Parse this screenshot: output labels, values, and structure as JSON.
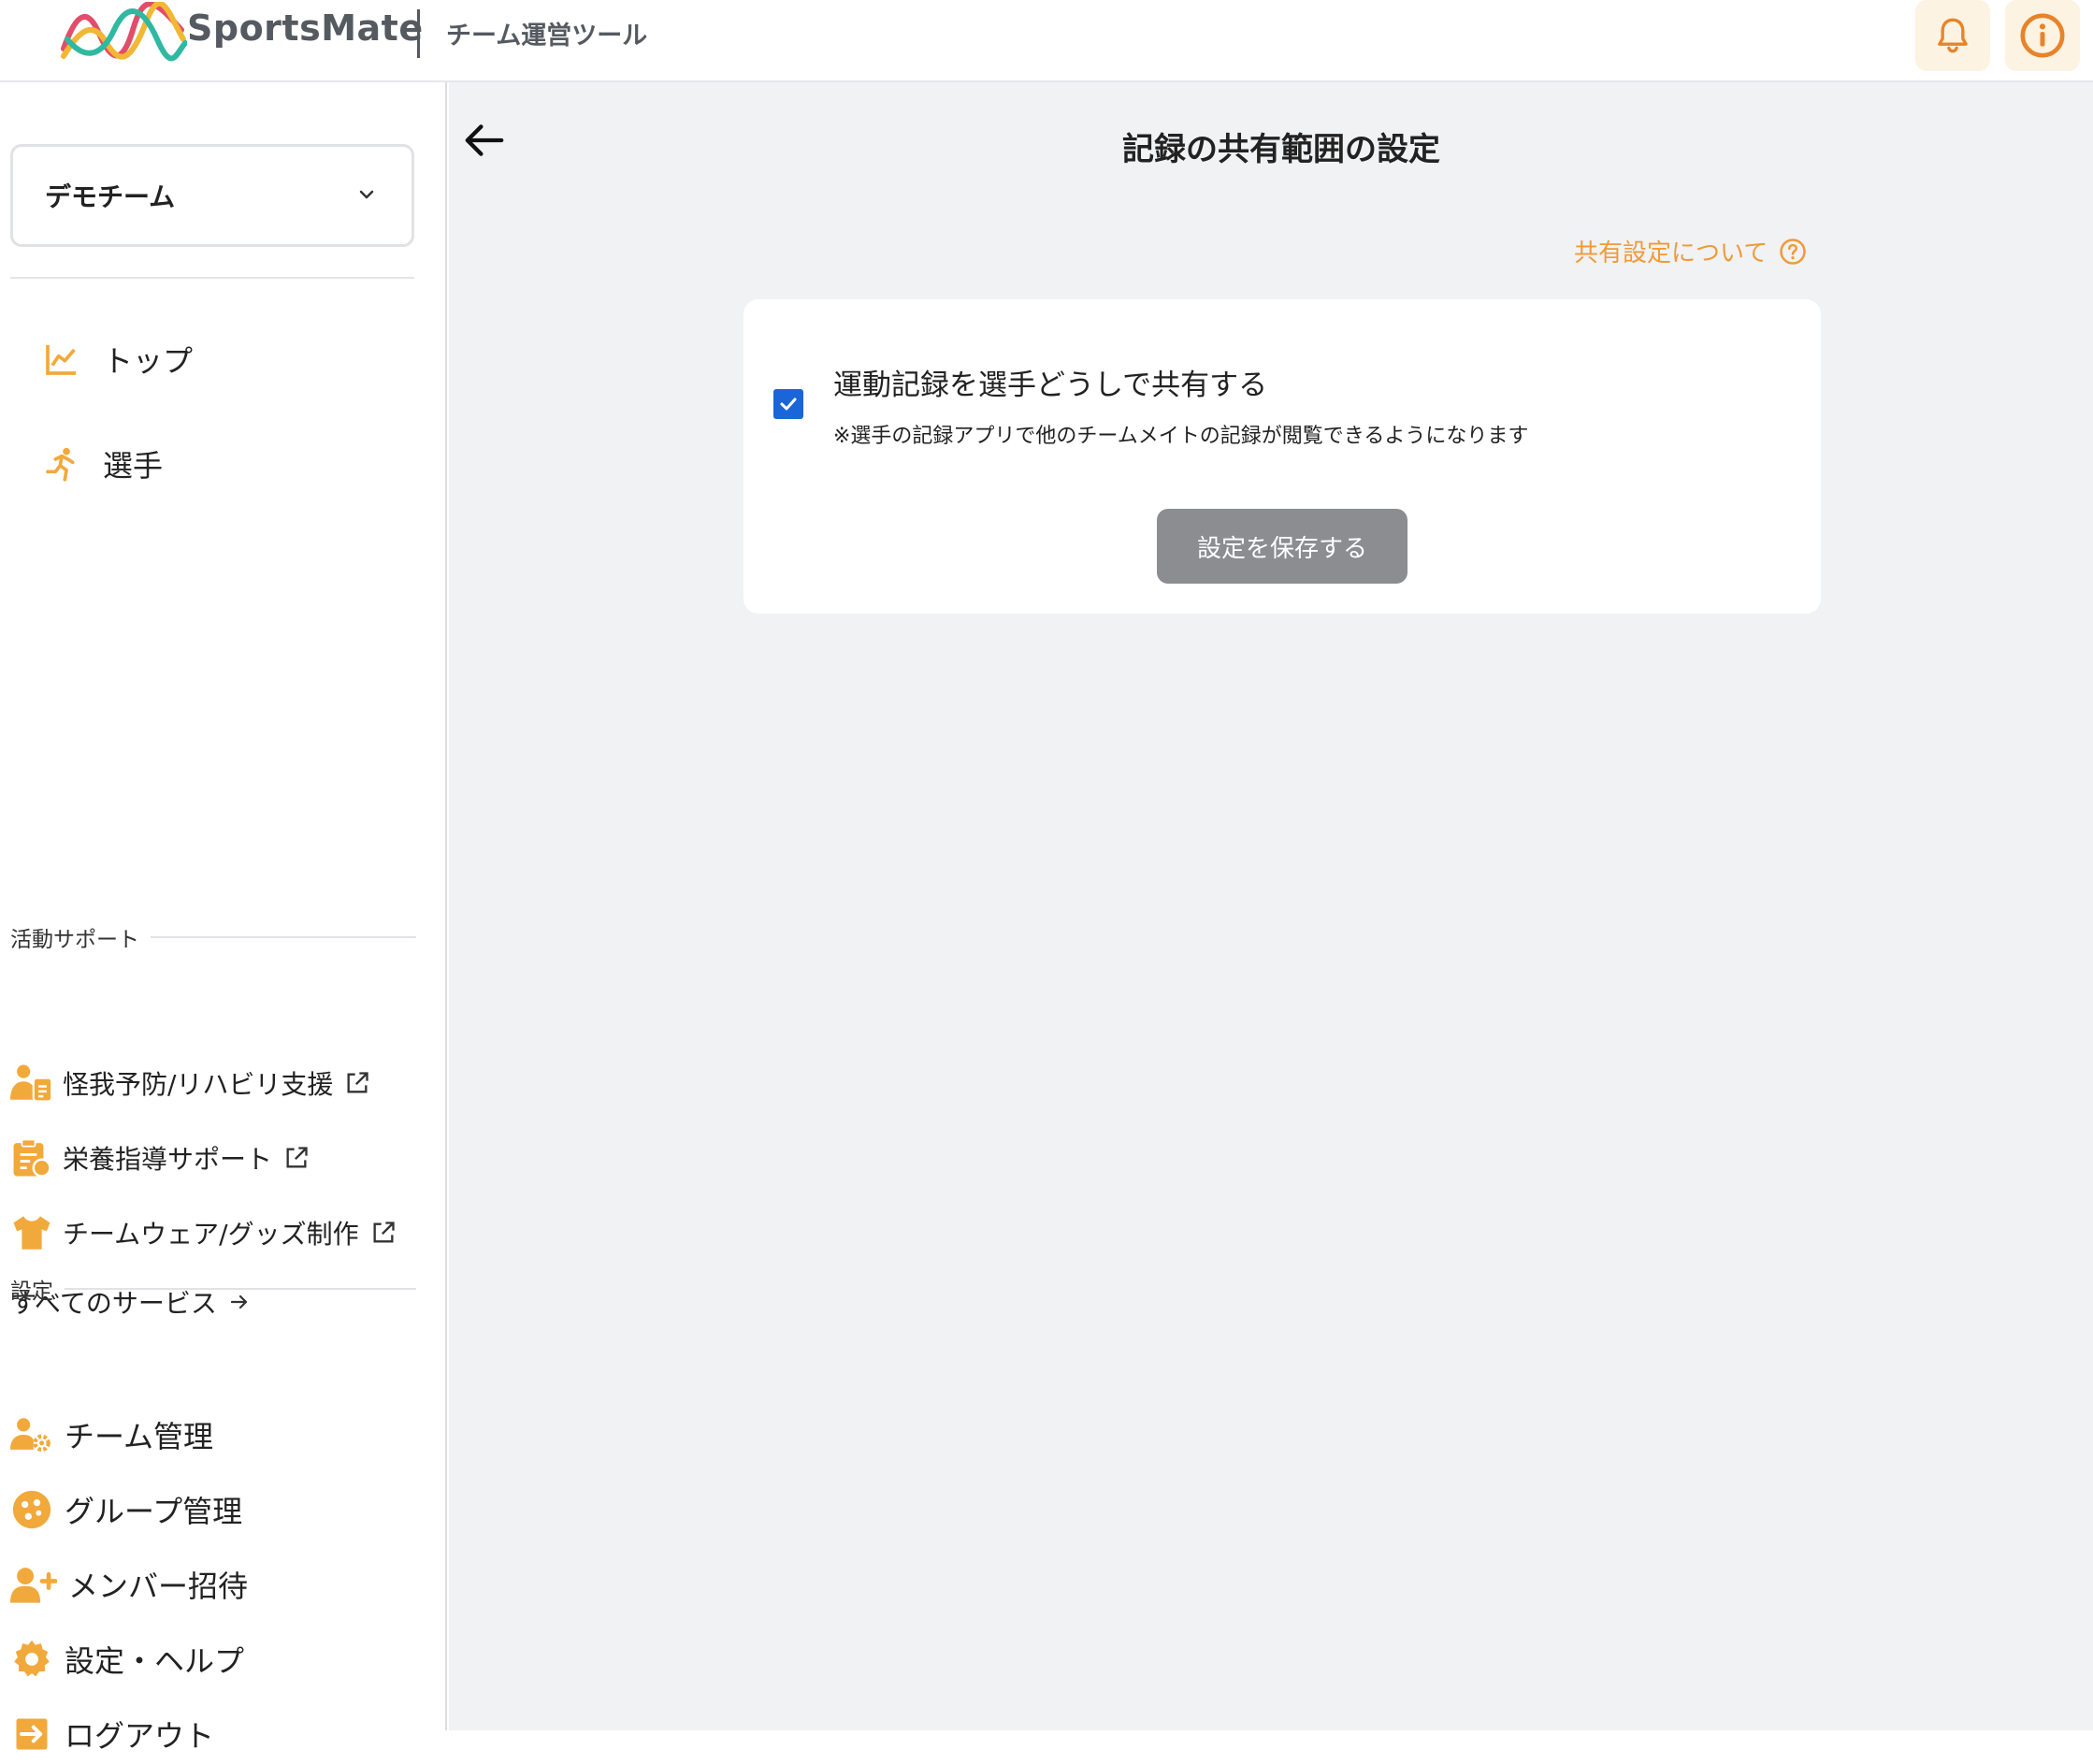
{
  "header": {
    "brand": "SportsMate",
    "app_title": "チーム運営ツール"
  },
  "sidebar": {
    "team_select": {
      "value": "デモチーム"
    },
    "nav": [
      {
        "label": "トップ",
        "icon": "chart-line-icon"
      },
      {
        "label": "選手",
        "icon": "runner-icon"
      }
    ],
    "activity_section": {
      "label": "活動サポート",
      "items": [
        {
          "label": "怪我予防/リハビリ支援",
          "icon": "medical-person-icon"
        },
        {
          "label": "栄養指導サポート",
          "icon": "clipboard-icon"
        },
        {
          "label": "チームウェア/グッズ制作",
          "icon": "tshirt-icon"
        }
      ],
      "all_services": "すべてのサービス"
    },
    "settings_section": {
      "label": "設定",
      "items": [
        {
          "label": "チーム管理",
          "icon": "team-gear-icon"
        },
        {
          "label": "グループ管理",
          "icon": "group-icon"
        },
        {
          "label": "メンバー招待",
          "icon": "add-user-icon"
        },
        {
          "label": "設定・ヘルプ",
          "icon": "gear-icon"
        },
        {
          "label": "ログアウト",
          "icon": "logout-icon"
        }
      ]
    }
  },
  "main": {
    "title": "記録の共有範囲の設定",
    "about_link": "共有設定について",
    "option": {
      "checked": true,
      "title": "運動記録を選手どうしで共有する",
      "note": "※選手の記録アプリで他のチームメイトの記録が閲覧できるようになります"
    },
    "save_label": "設定を保存する"
  },
  "colors": {
    "accent_orange": "#f2a93b",
    "link_orange": "#ef9a3a",
    "checkbox_blue": "#1a66d8",
    "button_disabled": "#8b8d91"
  }
}
